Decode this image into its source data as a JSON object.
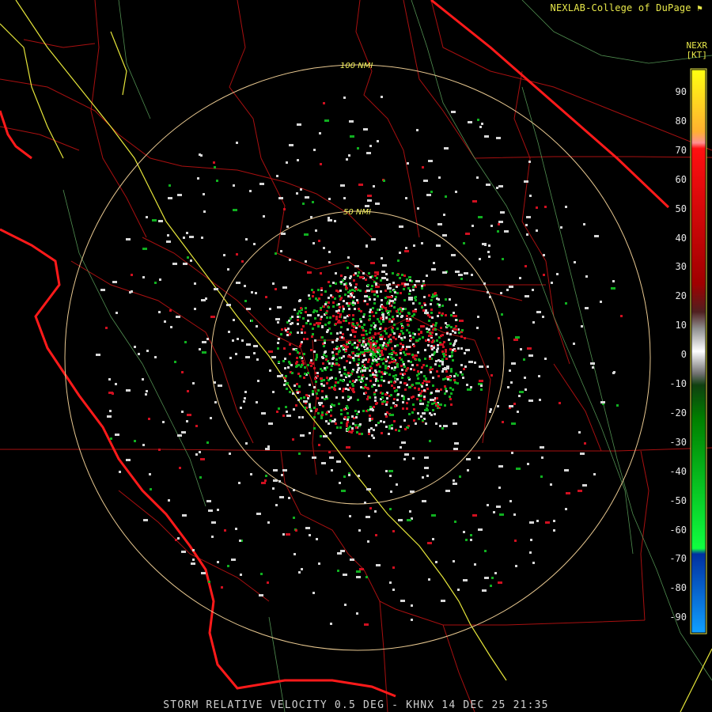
{
  "credit": "NEXLAB-College of DuPage",
  "scale": {
    "product": "NEXR",
    "unit": "[KT]",
    "ticks": [
      "90",
      "80",
      "70",
      "60",
      "50",
      "40",
      "30",
      "20",
      "10",
      "0",
      "-10",
      "-20",
      "-30",
      "-40",
      "-50",
      "-60",
      "-70",
      "-80",
      "-90"
    ]
  },
  "rings": [
    {
      "label": "100 NMI"
    },
    {
      "label": "50 NMI"
    }
  ],
  "caption": "STORM RELATIVE VELOCITY 0.5 DEG - KHNX 14 DEC 25 21:35",
  "colors": {
    "background": "#000000",
    "county_lines": "#b01010",
    "coastline": "#ff1a1a",
    "river_lines": "#e8e836",
    "terrain_lines": "#6fbf6f",
    "ring": "#e8c890",
    "text": "#e8e84a",
    "echo_inbound": "#10b020",
    "echo_outbound": "#d01020",
    "echo_null": "#d8d8d8"
  },
  "icons": [
    "flag-icon"
  ]
}
